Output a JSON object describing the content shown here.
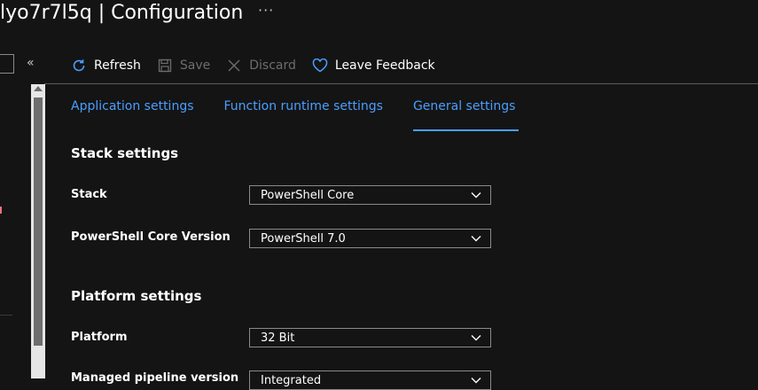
{
  "header": {
    "title": "lyo7r7l5q | Configuration",
    "more_label": "···"
  },
  "toolbar": {
    "refresh": "Refresh",
    "save": "Save",
    "discard": "Discard",
    "feedback": "Leave Feedback"
  },
  "tabs": [
    {
      "label": "Application settings"
    },
    {
      "label": "Function runtime settings"
    },
    {
      "label": "General settings"
    }
  ],
  "stack_settings": {
    "title": "Stack settings",
    "stack_label": "Stack",
    "stack_value": "PowerShell Core",
    "version_label": "PowerShell Core Version",
    "version_value": "PowerShell 7.0"
  },
  "platform_settings": {
    "title": "Platform settings",
    "platform_label": "Platform",
    "platform_value": "32 Bit",
    "pipeline_label": "Managed pipeline version",
    "pipeline_value": "Integrated"
  },
  "colors": {
    "accent": "#4a9eff",
    "background": "#141414"
  }
}
